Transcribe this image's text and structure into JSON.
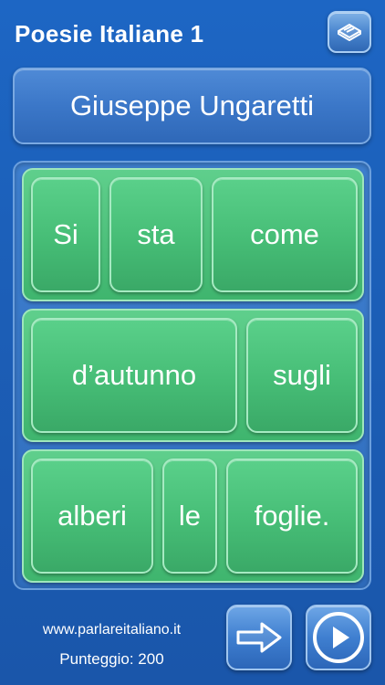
{
  "header": {
    "title": "Poesie Italiane 1",
    "top_button_icon": "book-icon"
  },
  "author": {
    "name": "Giuseppe Ungaretti"
  },
  "board": {
    "rows": [
      {
        "words": [
          "Si",
          "sta",
          "come"
        ]
      },
      {
        "words": [
          "d’autunno",
          "sugli"
        ]
      },
      {
        "words": [
          "alberi",
          "le",
          "foglie."
        ]
      }
    ]
  },
  "footer": {
    "website": "www.parlareitaliano.it",
    "score": "Punteggio: 200",
    "next_button_icon": "arrow-right-icon",
    "play_button_icon": "play-icon"
  },
  "colors": {
    "background": "#1c5fb8",
    "tile_green": "#46bd76",
    "button_blue": "#3f7fd0"
  }
}
